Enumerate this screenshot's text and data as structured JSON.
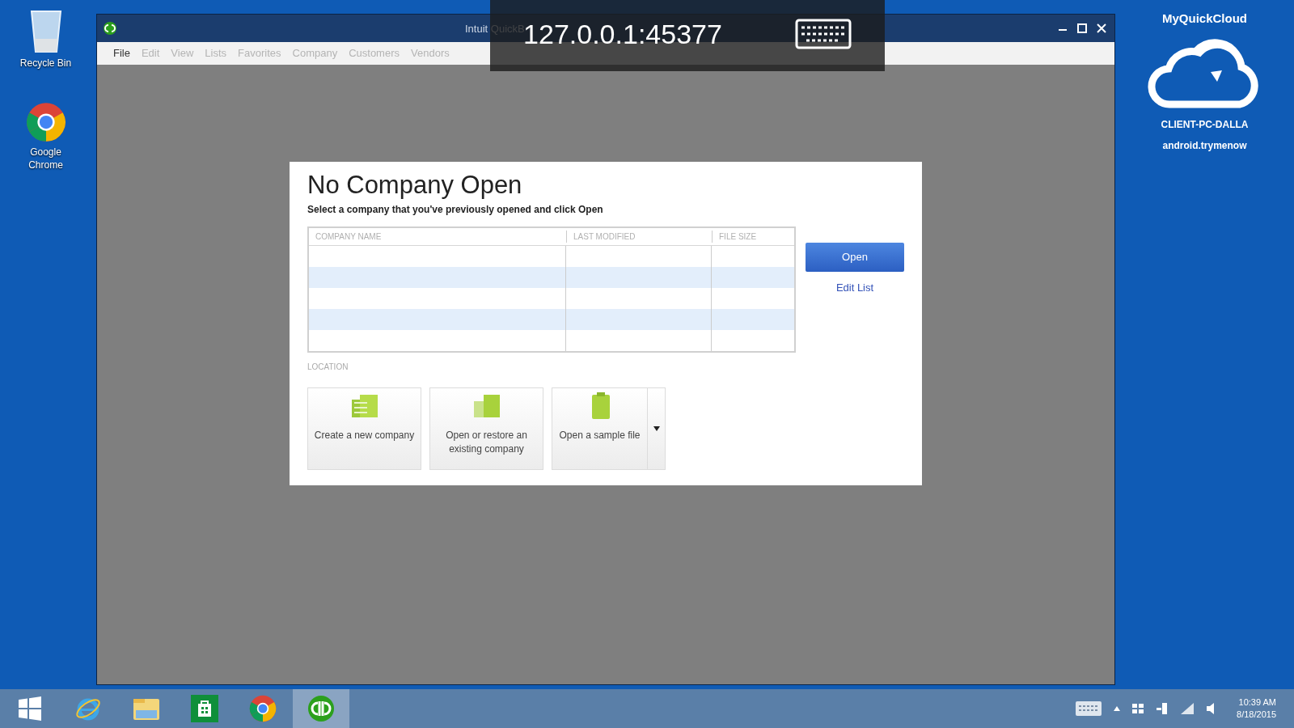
{
  "desktop_icons": [
    {
      "kind": "recycle",
      "label": "Recycle Bin"
    },
    {
      "kind": "chrome",
      "label": "Google Chrome"
    }
  ],
  "window": {
    "title": "Intuit QuickB",
    "menu": [
      "File",
      "Edit",
      "View",
      "Lists",
      "Favorites",
      "Company",
      "Customers",
      "Vendors"
    ]
  },
  "remote_overlay": {
    "address": "127.0.0.1:45377"
  },
  "dialog": {
    "title": "No Company Open",
    "subtitle": "Select a company that you've previously opened and click Open",
    "table": {
      "columns": [
        "COMPANY NAME",
        "LAST MODIFIED",
        "FILE SIZE"
      ]
    },
    "open_button": "Open",
    "edit_list_link": "Edit List",
    "location_label": "LOCATION",
    "actions": [
      {
        "label": "Create a new company",
        "kind": "create"
      },
      {
        "label": "Open or restore an existing company",
        "kind": "restore"
      },
      {
        "label": "Open a sample file",
        "kind": "sample"
      }
    ]
  },
  "brand": {
    "name": "MyQuickCloud",
    "host": "CLIENT-PC-DALLA",
    "domain": "android.trymenow"
  },
  "taskbar": {
    "apps": [
      {
        "kind": "start",
        "selected": false
      },
      {
        "kind": "ie",
        "selected": false
      },
      {
        "kind": "explorer",
        "selected": false
      },
      {
        "kind": "store",
        "selected": false
      },
      {
        "kind": "chrome",
        "selected": false
      },
      {
        "kind": "quickbooks",
        "selected": true
      }
    ],
    "time": "10:39 AM",
    "date": "8/18/2015"
  }
}
